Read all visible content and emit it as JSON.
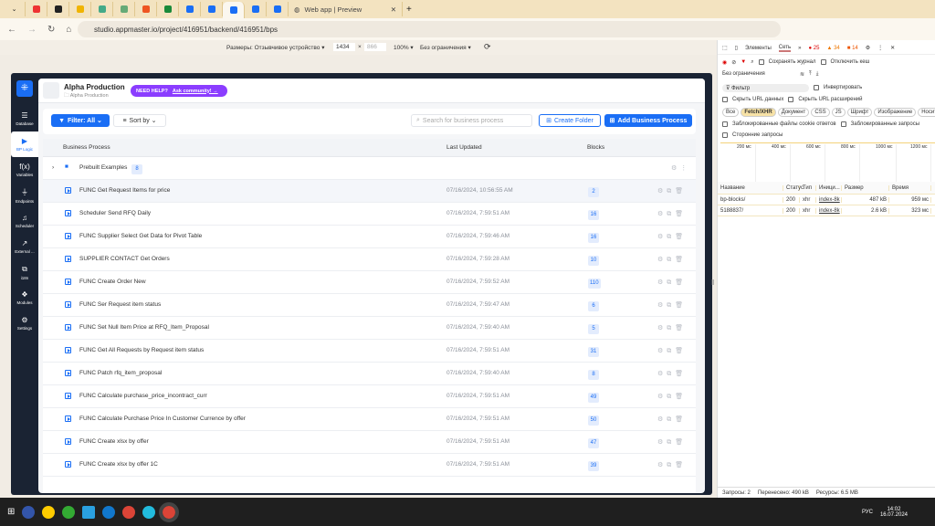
{
  "browser": {
    "tabs": [
      {
        "color": "#e33"
      },
      {
        "color": "#222"
      },
      {
        "color": "#f0b400"
      },
      {
        "color": "#4a8"
      },
      {
        "color": "#6a7"
      },
      {
        "color": "#e52"
      },
      {
        "color": "#1a8a3a"
      },
      {
        "color": "#1a6ef5"
      },
      {
        "color": "#1a6ef5"
      },
      {
        "color": "#1a6ef5",
        "active": true
      },
      {
        "color": "#1a6ef5"
      },
      {
        "color": "#1a6ef5"
      }
    ],
    "preview_tab": "Web app | Preview",
    "url": "studio.appmaster.io/project/416951/backend/416951/bps"
  },
  "device_toolbar": {
    "dimensions": "Размеры: Отзывчивое устройство ▾",
    "width": "1434",
    "height": "866",
    "zoom": "100% ▾",
    "throttle": "Без ограничения ▾"
  },
  "sidebar": {
    "items": [
      {
        "label": "Database",
        "icon": "database-icon",
        "glyph": "☰"
      },
      {
        "label": "BP Logic",
        "icon": "bp-logic-icon",
        "glyph": "▶",
        "active": true
      },
      {
        "label": "Variables",
        "icon": "function-icon",
        "glyph": "f(x)"
      },
      {
        "label": "Endpoints",
        "icon": "plug-icon",
        "glyph": "⏚"
      },
      {
        "label": "Scheduler",
        "icon": "bell-icon",
        "glyph": "♫"
      },
      {
        "label": "External ...",
        "icon": "external-icon",
        "glyph": "↗"
      },
      {
        "label": "i18n",
        "icon": "translate-icon",
        "glyph": "⧉"
      },
      {
        "label": "Modules",
        "icon": "modules-icon",
        "glyph": "❖"
      },
      {
        "label": "Settings",
        "icon": "gear-icon",
        "glyph": "⚙"
      }
    ]
  },
  "header": {
    "title": "Alpha Production",
    "breadcrumb": "Alpha Production",
    "help": "NEED HELP?",
    "community": "Ask community! →"
  },
  "toolbar": {
    "filter": "Filter: All ⌄",
    "sort": "Sort by ⌄",
    "search_placeholder": "Search for business process",
    "create_folder": "Create Folder",
    "add_bp": "Add Business Process"
  },
  "table": {
    "columns": [
      "Business Process",
      "Last Updated",
      "Blocks"
    ],
    "folder": {
      "name": "Prebuilt Examples",
      "count": "8"
    },
    "rows": [
      [
        "FUNC Get Request Items for price",
        "07/16/2024, 10:56:55 AM",
        "2"
      ],
      [
        "Scheduler Send RFQ Daily",
        "07/16/2024, 7:59:51 AM",
        "16"
      ],
      [
        "FUNC Supplier Select Get Data for Pivot Table",
        "07/16/2024, 7:59:46 AM",
        "16"
      ],
      [
        "SUPPLIER CONTACT Get Orders",
        "07/16/2024, 7:59:28 AM",
        "10"
      ],
      [
        "FUNC Create Order New",
        "07/16/2024, 7:59:52 AM",
        "110"
      ],
      [
        "FUNC Ser Request item status",
        "07/16/2024, 7:59:47 AM",
        "6"
      ],
      [
        "FUNC Set Null Item Price at RFQ_Item_Proposal",
        "07/16/2024, 7:59:40 AM",
        "5"
      ],
      [
        "FUNC Get All Requests by Request item status",
        "07/16/2024, 7:59:51 AM",
        "31"
      ],
      [
        "FUNC Patch rfq_item_proposal",
        "07/16/2024, 7:59:40 AM",
        "8"
      ],
      [
        "FUNC Calculate purchase_price_incontract_curr",
        "07/16/2024, 7:59:51 AM",
        "49"
      ],
      [
        "FUNC Calculate Purchase Price In Customer Currence by offer",
        "07/16/2024, 7:59:51 AM",
        "50"
      ],
      [
        "FUNC Create xlsx by offer",
        "07/16/2024, 7:59:51 AM",
        "47"
      ],
      [
        "FUNC Create xlsx by offer 1C",
        "07/16/2024, 7:59:51 AM",
        "39"
      ]
    ]
  },
  "devtools": {
    "tabs": [
      "Элементы",
      "Сеть",
      "»"
    ],
    "errors": "25",
    "warnings": "34",
    "info": "14",
    "preserve_log": "Сохранять журнал",
    "disable_cache": "Отключить кеш",
    "throttle": "Без ограничения",
    "filter": "Фильтр",
    "invert": "Инвертировать",
    "hide_data_urls": "Скрыть URL данных",
    "hide_ext_urls": "Скрыть URL расширений",
    "types": [
      "Все",
      "Fetch/XHR",
      "Документ",
      "CSS",
      "JS",
      "Шрифт",
      "Изображение",
      "Носитель"
    ],
    "blocked_cookies": "Заблокированные файлы cookie ответов",
    "blocked_requests": "Заблокированные запросы",
    "third_party": "Сторонние запросы",
    "timeline": [
      "200 мс",
      "400 мс",
      "600 мс",
      "800 мс",
      "1000 мс",
      "1200 мс"
    ],
    "columns": [
      "Название",
      "Статус",
      "Тип",
      "Иници...",
      "Размер",
      "Время"
    ],
    "requests": [
      [
        "bp-blocks/",
        "200",
        "xhr",
        "index-8k",
        "487 kB",
        "959 мс"
      ],
      [
        "5188837/",
        "200",
        "xhr",
        "index-8k",
        "2.6 kB",
        "323 мс"
      ]
    ],
    "status": [
      "Запросы: 2",
      "Перенесено: 490 kB",
      "Ресурсы: 6.5 MB"
    ]
  },
  "taskbar": {
    "lang": "РУС",
    "time": "14:02",
    "date": "16.07.2024"
  },
  "colors": {
    "accent": "#1a6ef5",
    "help": "#8b3dff",
    "sidebar": "#1a2333"
  }
}
